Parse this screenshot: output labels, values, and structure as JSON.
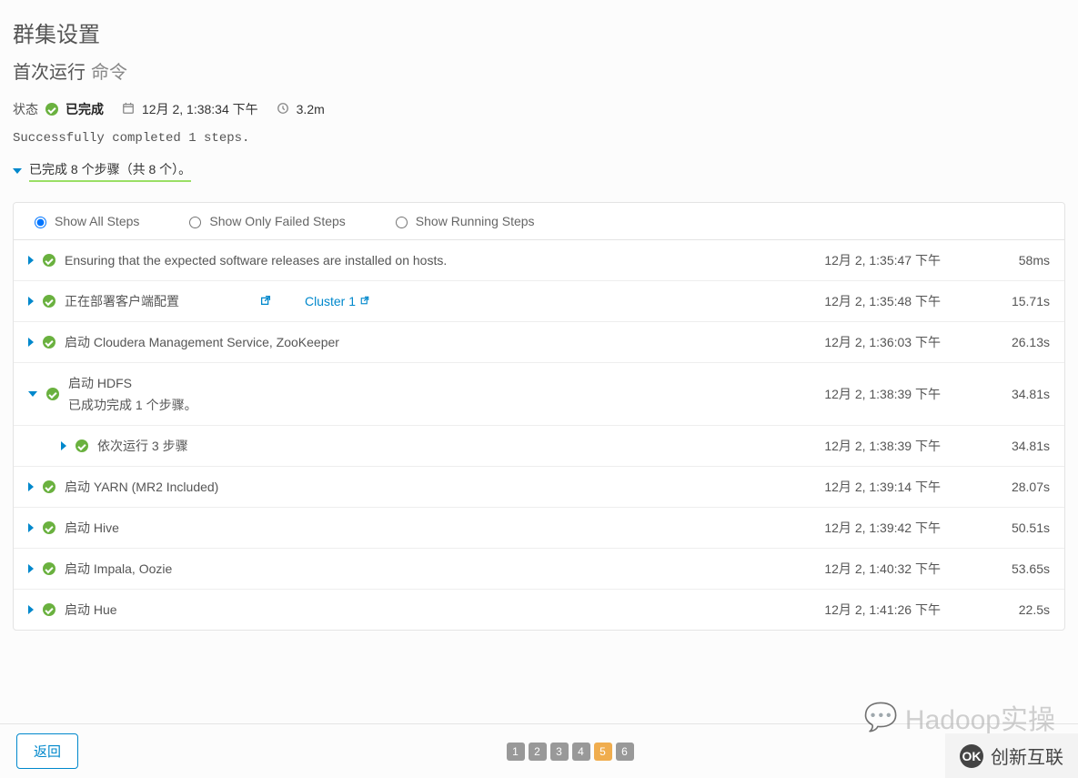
{
  "page": {
    "title": "群集设置",
    "subtitle_main": "首次运行",
    "subtitle_light": "命令"
  },
  "status_bar": {
    "state_label": "状态",
    "state_value": "已完成",
    "datetime": "12月 2, 1:38:34 下午",
    "duration": "3.2m"
  },
  "completion_message": "Successfully completed 1 steps.",
  "summary": {
    "completed_line": "已完成 8 个步骤（共 8 个）。"
  },
  "filters": {
    "all": "Show All Steps",
    "failed": "Show Only Failed Steps",
    "running": "Show Running Steps",
    "selected": "all"
  },
  "steps": [
    {
      "expand": "right",
      "desc": "Ensuring that the expected software releases are installed on hosts.",
      "time": "12月 2, 1:35:47 下午",
      "dur": "58ms"
    },
    {
      "expand": "right",
      "desc": "正在部署客户端配置",
      "link_label": "Cluster 1",
      "time": "12月 2, 1:35:48 下午",
      "dur": "15.71s"
    },
    {
      "expand": "right",
      "desc": "启动 Cloudera Management Service, ZooKeeper",
      "time": "12月 2, 1:36:03 下午",
      "dur": "26.13s"
    },
    {
      "expand": "down",
      "desc": "启动 HDFS",
      "sub_note": "已成功完成  1  个步骤。",
      "time": "12月 2, 1:38:39 下午",
      "dur": "34.81s"
    },
    {
      "expand": "right",
      "nested": true,
      "desc": "依次运行 3 步骤",
      "time": "12月 2, 1:38:39 下午",
      "dur": "34.81s"
    },
    {
      "expand": "right",
      "desc": "启动 YARN (MR2 Included)",
      "time": "12月 2, 1:39:14 下午",
      "dur": "28.07s"
    },
    {
      "expand": "right",
      "desc": "启动 Hive",
      "time": "12月 2, 1:39:42 下午",
      "dur": "50.51s"
    },
    {
      "expand": "right",
      "desc": "启动 Impala, Oozie",
      "time": "12月 2, 1:40:32 下午",
      "dur": "53.65s"
    },
    {
      "expand": "right",
      "desc": "启动 Hue",
      "time": "12月 2, 1:41:26 下午",
      "dur": "22.5s"
    }
  ],
  "bottom": {
    "back_button": "返回",
    "pages": [
      "1",
      "2",
      "3",
      "4",
      "5",
      "6"
    ],
    "active_page": "5"
  },
  "watermark": "Hadoop实操",
  "corner_logo": "创新互联"
}
